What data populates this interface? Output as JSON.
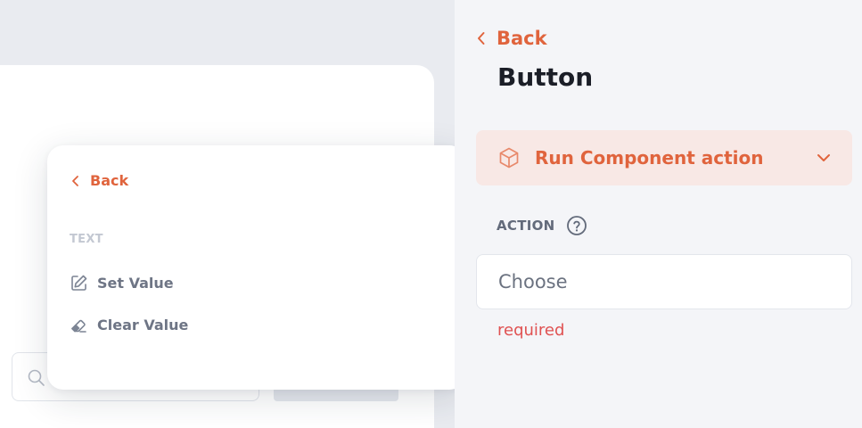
{
  "popup": {
    "back_label": "Back",
    "section_label": "TEXT",
    "items": [
      {
        "label": "Set Value",
        "icon": "edit-icon"
      },
      {
        "label": "Clear Value",
        "icon": "eraser-icon"
      }
    ]
  },
  "panel": {
    "back_label": "Back",
    "title": "Button",
    "action_type": {
      "label": "Run Component action",
      "icon": "cube-icon"
    },
    "field_label": "ACTION",
    "field_placeholder": "Choose",
    "validation": "required"
  },
  "colors": {
    "accent": "#e0643d",
    "accent_bg": "#f8e8e5",
    "error": "#e05252"
  }
}
